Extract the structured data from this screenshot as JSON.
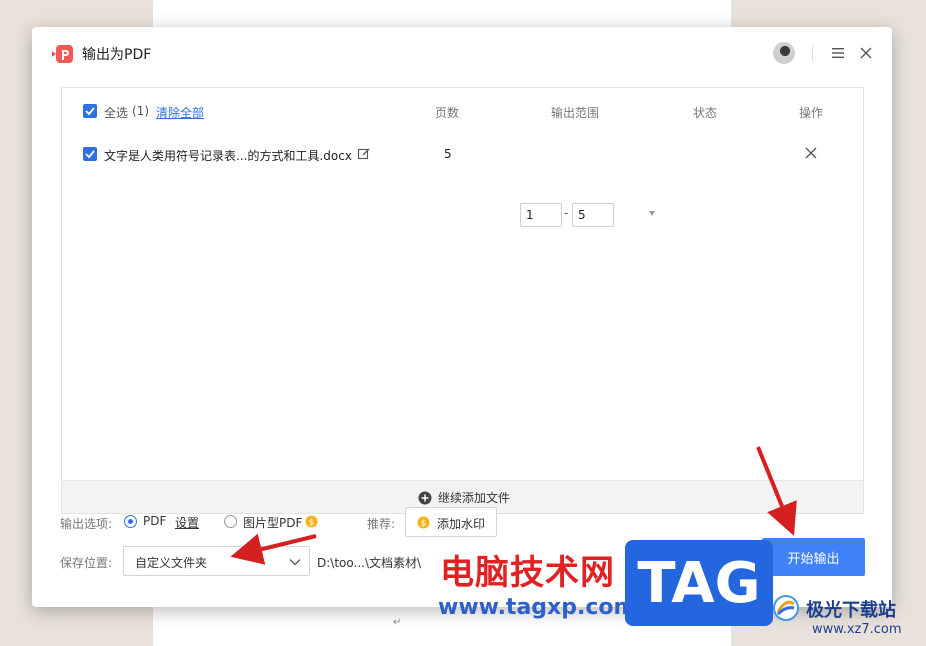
{
  "dialog": {
    "title": "输出为PDF"
  },
  "table": {
    "select_all_label": "全选",
    "select_count": "(1)",
    "clear_all_link": "清除全部",
    "columns": {
      "pages": "页数",
      "range": "输出范围",
      "status": "状态",
      "action": "操作"
    },
    "rows": [
      {
        "filename": "文字是人类用符号记录表...的方式和工具.docx",
        "pages": "5",
        "range_from": "1",
        "range_separator": "-",
        "range_to": "5",
        "status": ""
      }
    ],
    "add_more_label": "继续添加文件"
  },
  "options": {
    "output_label": "输出选项:",
    "pdf_option": "PDF",
    "settings_link": "设置",
    "image_pdf_option": "图片型PDF",
    "recommend_label": "推荐:",
    "watermark_button": "添加水印",
    "save_label": "保存位置:",
    "save_location_value": "自定义文件夹",
    "save_path": "D:\\too...\\文档素材\\"
  },
  "start_button": "开始输出",
  "overlay": {
    "site_name": "电脑技术网",
    "site_url": "www.tagxp.com",
    "tag_logo": "TAG",
    "xz7_name": "极光下载站",
    "xz7_url": "www.xz7.com"
  },
  "colors": {
    "accent": "#2f6fe0",
    "primary_button": "#3f82f7",
    "arrow": "#d42020"
  }
}
